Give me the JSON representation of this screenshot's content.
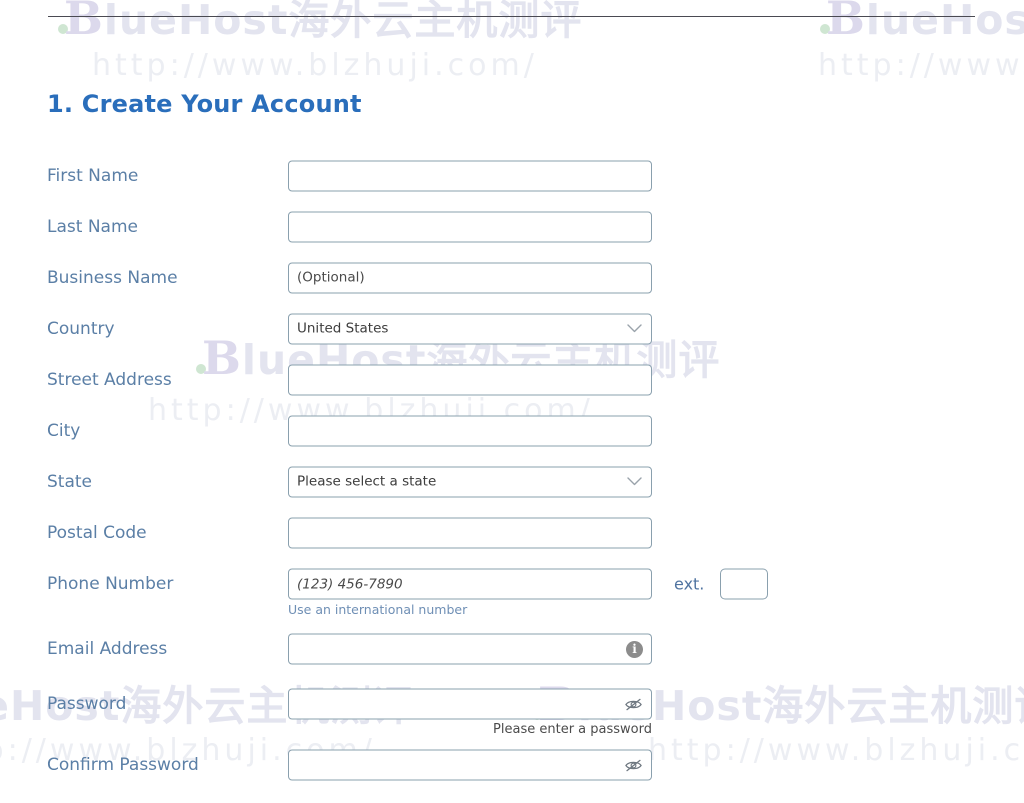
{
  "heading": "1. Create Your Account",
  "watermark": {
    "brand_prefix": "B",
    "brand_text": "lueHost海外云主机测评",
    "url_text": "http://www.blzhuji.com/"
  },
  "colors": {
    "heading_blue": "#2a6ebb",
    "label_blue": "#5b7fa6",
    "field_border": "#8aa0ae",
    "help_link": "#6f8fb5",
    "watermark": "#e3e4ef",
    "watermark_dot_green": "#cfe6d2"
  },
  "form": {
    "rows": [
      {
        "label": "First Name",
        "type": "text",
        "value": "",
        "placeholder": ""
      },
      {
        "label": "Last Name",
        "type": "text",
        "value": "",
        "placeholder": ""
      },
      {
        "label": "Business Name",
        "type": "text",
        "value": "",
        "placeholder": "(Optional)"
      },
      {
        "label": "Country",
        "type": "select",
        "value": "United States",
        "placeholder": ""
      },
      {
        "label": "Street Address",
        "type": "text",
        "value": "",
        "placeholder": ""
      },
      {
        "label": "City",
        "type": "text",
        "value": "",
        "placeholder": ""
      },
      {
        "label": "State",
        "type": "select",
        "value": "Please select a state",
        "placeholder": ""
      },
      {
        "label": "Postal Code",
        "type": "text",
        "value": "",
        "placeholder": ""
      },
      {
        "label": "Phone Number",
        "type": "phone",
        "value": "",
        "placeholder": "(123) 456-7890"
      },
      {
        "label": "Email Address",
        "type": "info",
        "value": "",
        "placeholder": ""
      },
      {
        "label": "Password",
        "type": "password",
        "value": "",
        "placeholder": ""
      },
      {
        "label": "Confirm Password",
        "type": "password",
        "value": "",
        "placeholder": ""
      }
    ],
    "phone_help": "Use an international number",
    "phone_ext_label": "ext.",
    "phone_ext_value": "",
    "password_error": "Please enter a password"
  }
}
